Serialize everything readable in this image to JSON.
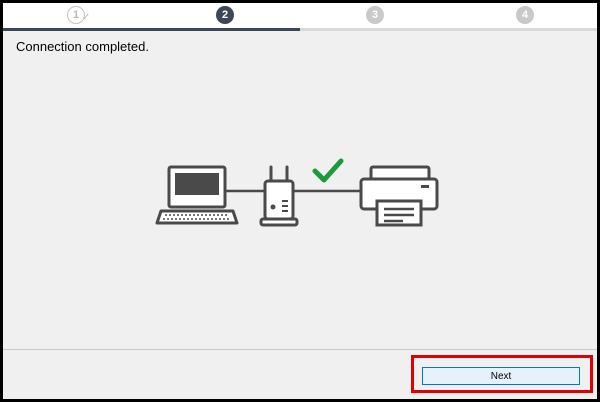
{
  "stepper": {
    "steps": [
      {
        "number": "1",
        "state": "done"
      },
      {
        "number": "2",
        "state": "active"
      },
      {
        "number": "3",
        "state": "todo"
      },
      {
        "number": "4",
        "state": "todo"
      }
    ],
    "done_glyph": "✓"
  },
  "main": {
    "status_text": "Connection completed."
  },
  "illustration": {
    "icons": [
      "laptop-icon",
      "wireless-router-icon",
      "checkmark-icon",
      "printer-icon"
    ],
    "line_color": "#4a4a4a",
    "check_color": "#1a9b3a"
  },
  "footer": {
    "next_label": "Next"
  },
  "colors": {
    "active_step": "#3c4759",
    "highlight": "#e00000",
    "button_border": "#0078d7"
  }
}
